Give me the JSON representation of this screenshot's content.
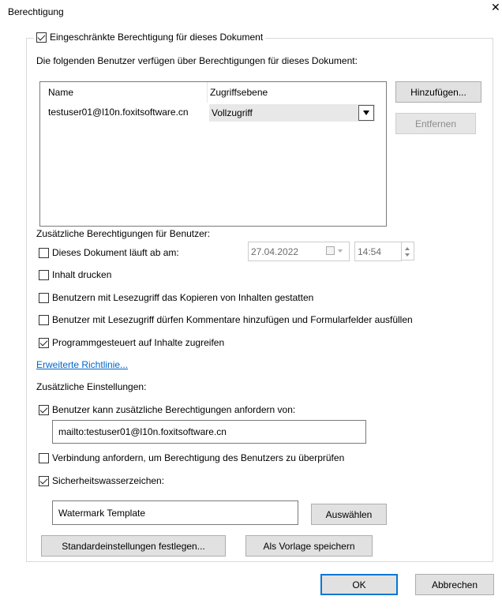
{
  "window": {
    "title": "Berechtigung",
    "close_glyph": "✕"
  },
  "restrict": {
    "label": "Eingeschränkte Berechtigung für dieses Dokument",
    "checked": true
  },
  "users_intro": "Die folgenden Benutzer verfügen über Berechtigungen für dieses Dokument:",
  "users_table": {
    "columns": [
      "Name",
      "Zugriffsebene"
    ],
    "rows": [
      {
        "user": "testuser01@l10n.foxitsoftware.cn",
        "access": "Vollzugriff"
      }
    ]
  },
  "buttons": {
    "add": "Hinzufügen...",
    "remove": "Entfernen",
    "defaults": "Standardeinstellungen festlegen...",
    "save_template": "Als Vorlage speichern",
    "choose": "Auswählen",
    "ok": "OK",
    "cancel": "Abbrechen"
  },
  "extra_permissions": {
    "heading": "Zusätzliche Berechtigungen für Benutzer:",
    "expires": {
      "label": "Dieses Dokument läuft ab am:",
      "checked": false,
      "date": "27.04.2022",
      "time": "14:54"
    },
    "print": {
      "label": "Inhalt drucken",
      "checked": false
    },
    "copy": {
      "label": "Benutzern mit Lesezugriff das Kopieren von Inhalten gestatten",
      "checked": false
    },
    "comment": {
      "label": "Benutzer mit Lesezugriff dürfen Kommentare hinzufügen und Formularfelder ausfüllen",
      "checked": false
    },
    "programmatic": {
      "label": "Programmgesteuert auf Inhalte zugreifen",
      "checked": true
    }
  },
  "advanced_policy_link": "Erweiterte Richtlinie...",
  "extra_settings": {
    "heading": "Zusätzliche Einstellungen:",
    "request": {
      "label": "Benutzer kann zusätzliche Berechtigungen anfordern von:",
      "checked": true,
      "value": "mailto:testuser01@l10n.foxitsoftware.cn"
    },
    "connection": {
      "label": "Verbindung anfordern, um Berechtigung des Benutzers zu überprüfen",
      "checked": false
    },
    "watermark": {
      "label": "Sicherheitswasserzeichen:",
      "checked": true,
      "value": "Watermark Template"
    }
  },
  "icons": {
    "calendar": "calendar-icon",
    "spinner": "spinner-icon",
    "dropdown": "chevron-down-icon",
    "close": "close-icon"
  }
}
